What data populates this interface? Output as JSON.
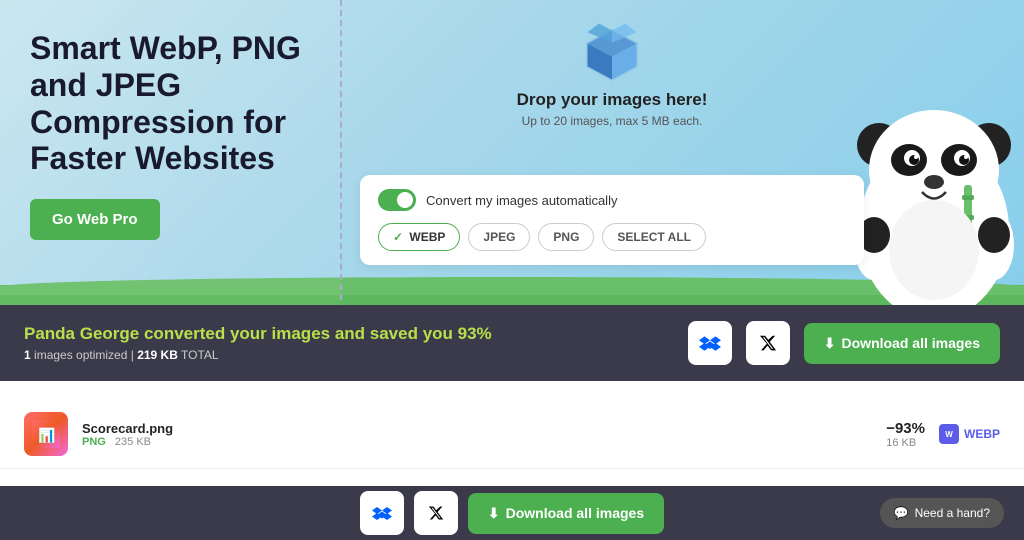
{
  "hero": {
    "title": "Smart WebP, PNG and JPEG Compression for Faster Websites",
    "cta_label": "Go Web Pro"
  },
  "dropzone": {
    "title": "Drop your images here!",
    "subtitle": "Up to 20 images, max 5 MB each."
  },
  "format_panel": {
    "toggle_label": "Convert my images automatically",
    "buttons": [
      {
        "id": "webp",
        "label": "WEBP",
        "active": true
      },
      {
        "id": "jpeg",
        "label": "JPEG",
        "active": false
      },
      {
        "id": "png",
        "label": "PNG",
        "active": false
      },
      {
        "id": "select_all",
        "label": "SELECT ALL",
        "active": false
      }
    ]
  },
  "results_bar": {
    "headline": "Panda George converted your images and saved you 93%",
    "images_count": "1",
    "images_label": "images optimized",
    "total_size": "219 KB",
    "total_label": "TOTAL",
    "download_label": "Download all images"
  },
  "image_row": {
    "filename": "Scorecard.png",
    "type": "PNG",
    "original_size": "235 KB",
    "savings_pct": "−93%",
    "output_size": "16 KB",
    "output_format": "WEBP"
  },
  "bottom_bar": {
    "download_label": "Download all images",
    "need_hand_label": "Need a hand?"
  },
  "icons": {
    "dropbox": "📦",
    "twitter_x": "✕",
    "download": "⬇",
    "chat": "💬"
  }
}
